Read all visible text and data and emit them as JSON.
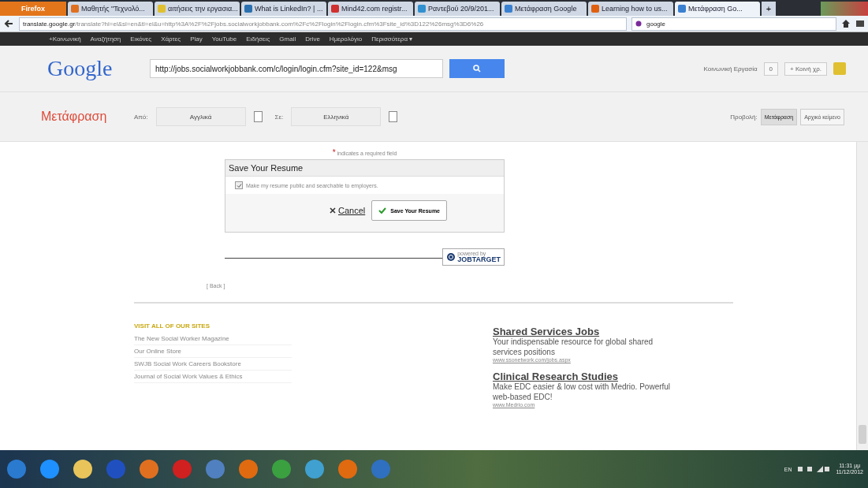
{
  "browser": {
    "menu_button": "Firefox",
    "tabs": [
      {
        "label": "Μαθητής \"Τεχνολό...",
        "selected": false
      },
      {
        "label": "αιτήσεις την εργασια...",
        "selected": false
      },
      {
        "label": "What is LinkedIn? | ...",
        "selected": false
      },
      {
        "label": "Mind42.com registr...",
        "selected": false
      },
      {
        "label": "Ραντεβού 20/9/201...",
        "selected": false
      },
      {
        "label": "Μετάφραση Google",
        "selected": false
      },
      {
        "label": "Learning how to us...",
        "selected": false
      },
      {
        "label": "Μετάφραση Go...",
        "selected": true
      }
    ],
    "new_tab": "+",
    "url_host": "translate.google.gr",
    "url_rest": "/translate?hl=el&sl=en&tl=el&u=http%3A%2F%2Fjobs.socialworkjobbank.com%2Fc%2Flogin%2Flogin.cfm%3Fsite_id%3D122%26msg%3D6%26",
    "search_value": "google"
  },
  "google_bar": [
    "+Κοινωνική",
    "Αναζήτηση",
    "Εικόνες",
    "Χάρτες",
    "Play",
    "YouTube",
    "Ειδήσεις",
    "Gmail",
    "Drive",
    "Ημερολόγιο",
    "Περισσότερα ▾"
  ],
  "header": {
    "logo": "Google",
    "search_value": "http://jobs.socialworkjobbank.com/c/login/login.cfm?site_id=122&msg",
    "user": "Κοινωνική Εργασία",
    "count": "0",
    "share": "+ Κοινή χρ."
  },
  "translate_bar": {
    "title": "Μετάφραση",
    "from_label": "Από:",
    "from_value": "Αγγλικά",
    "to_label": "Σε:",
    "to_value": "Ελληνικά",
    "view_label": "Προβολή:",
    "views": [
      {
        "label": "Μετάφραση",
        "selected": true
      },
      {
        "label": "Αρχικό κείμενο",
        "selected": false
      }
    ]
  },
  "form": {
    "required_mark": "*",
    "required_note": "indicates a required field",
    "panel_title": "Save Your Resume",
    "checkbox": {
      "label": "Make my resume public and searchable to employers.",
      "checked": true
    },
    "cancel": "Cancel",
    "save": "Save Your Resume",
    "badge_small": "powered by",
    "badge": "JOBTARGET",
    "back": "[ Back ]"
  },
  "footer": {
    "heading": "VISIT ALL OF OUR SITES",
    "links": [
      "The New Social Worker Magazine",
      "Our Online Store",
      "SWJB Social Work Careers Bookstore",
      "Journal of Social Work Values & Ethics"
    ],
    "ads": [
      {
        "title": "Shared Services Jobs",
        "text": "Your indispensable resource for global shared services positions",
        "url": "www.ssonetwork.com/jobs.aspx"
      },
      {
        "title": "Clinical Research Studies",
        "text": "Make EDC easier & low cost with Medrio. Powerful web-based EDC!",
        "url": "www.Medrio.com"
      }
    ]
  },
  "taskbar": {
    "language": "EN",
    "time": "11:31 μμ",
    "date": "11/12/2012"
  }
}
